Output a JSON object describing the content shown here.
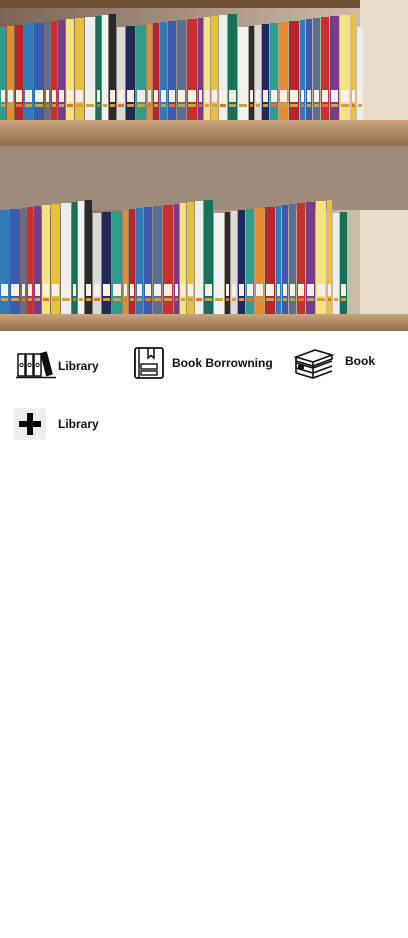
{
  "hero": {
    "image": "bookshelf-photo"
  },
  "menu": {
    "items": [
      {
        "id": "library",
        "label": "Library",
        "icon": "bookshelf-icon"
      },
      {
        "id": "borrow",
        "label": "Book Borrowning",
        "icon": "book-borrow-icon"
      },
      {
        "id": "book",
        "label": "Book",
        "icon": "book-stack-icon"
      },
      {
        "id": "add",
        "label": "Library",
        "icon": "plus-icon"
      }
    ]
  }
}
